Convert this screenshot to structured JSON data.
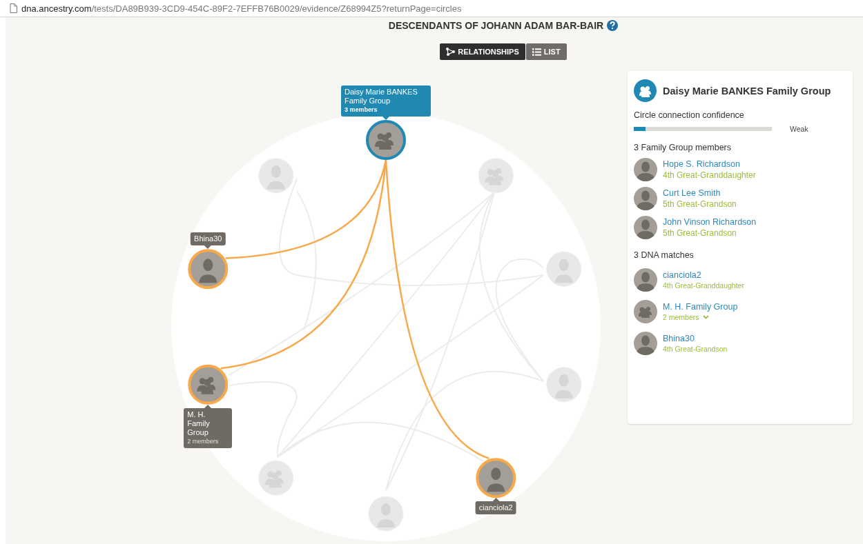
{
  "address_bar": {
    "host": "dna.ancestry.com",
    "path": "/tests/DA89B939-3CD9-454C-89F2-7EFFB76B0029/evidence/Z68994Z5?returnPage=circles"
  },
  "title": "DESCENDANTS OF JOHANN ADAM BAR-BAIR",
  "view_tabs": [
    {
      "label": "RELATIONSHIPS",
      "kind": "relationships",
      "selected": true
    },
    {
      "label": "LIST",
      "kind": "list",
      "selected": false
    }
  ],
  "circle_nodes": [
    {
      "kind": "group",
      "focused": true,
      "highlighted": false,
      "label": "Daisy Marie BANKES Family Group",
      "sublabel": "3 members"
    },
    {
      "kind": "person",
      "focused": false,
      "highlighted": false
    },
    {
      "kind": "group",
      "focused": false,
      "highlighted": false
    },
    {
      "kind": "person",
      "focused": false,
      "highlighted": true,
      "label": "Bhina30"
    },
    {
      "kind": "person",
      "focused": false,
      "highlighted": false
    },
    {
      "kind": "group",
      "focused": false,
      "highlighted": true,
      "label": "M. H. Family Group",
      "sublabel": "2 members"
    },
    {
      "kind": "person",
      "focused": false,
      "highlighted": false
    },
    {
      "kind": "group",
      "focused": false,
      "highlighted": false
    },
    {
      "kind": "person",
      "focused": false,
      "highlighted": true,
      "label": "cianciola2"
    },
    {
      "kind": "person",
      "focused": false,
      "highlighted": false
    }
  ],
  "panel": {
    "title": "Daisy Marie BANKES Family Group",
    "confidence_label": "Circle connection confidence",
    "confidence": {
      "level": 0.085,
      "reading": "Weak"
    },
    "members_heading": "3 Family Group members",
    "members": [
      {
        "kind": "person",
        "name": "Hope S. Richardson",
        "relation": "4th Great-Granddaughter"
      },
      {
        "kind": "person",
        "name": "Curt Lee Smith",
        "relation": "5th Great-Grandson"
      },
      {
        "kind": "person",
        "name": "John Vinson Richardson",
        "relation": "5th Great-Grandson"
      }
    ],
    "matches_heading": "3 DNA matches",
    "matches": [
      {
        "kind": "person",
        "name": "cianciola2",
        "detail": "4th Great-Granddaughter"
      },
      {
        "kind": "group",
        "name": "M. H. Family Group",
        "detail": "2 members",
        "expanded": false
      },
      {
        "kind": "person",
        "name": "Bhina30",
        "detail": "4th Great-Grandson"
      }
    ]
  }
}
